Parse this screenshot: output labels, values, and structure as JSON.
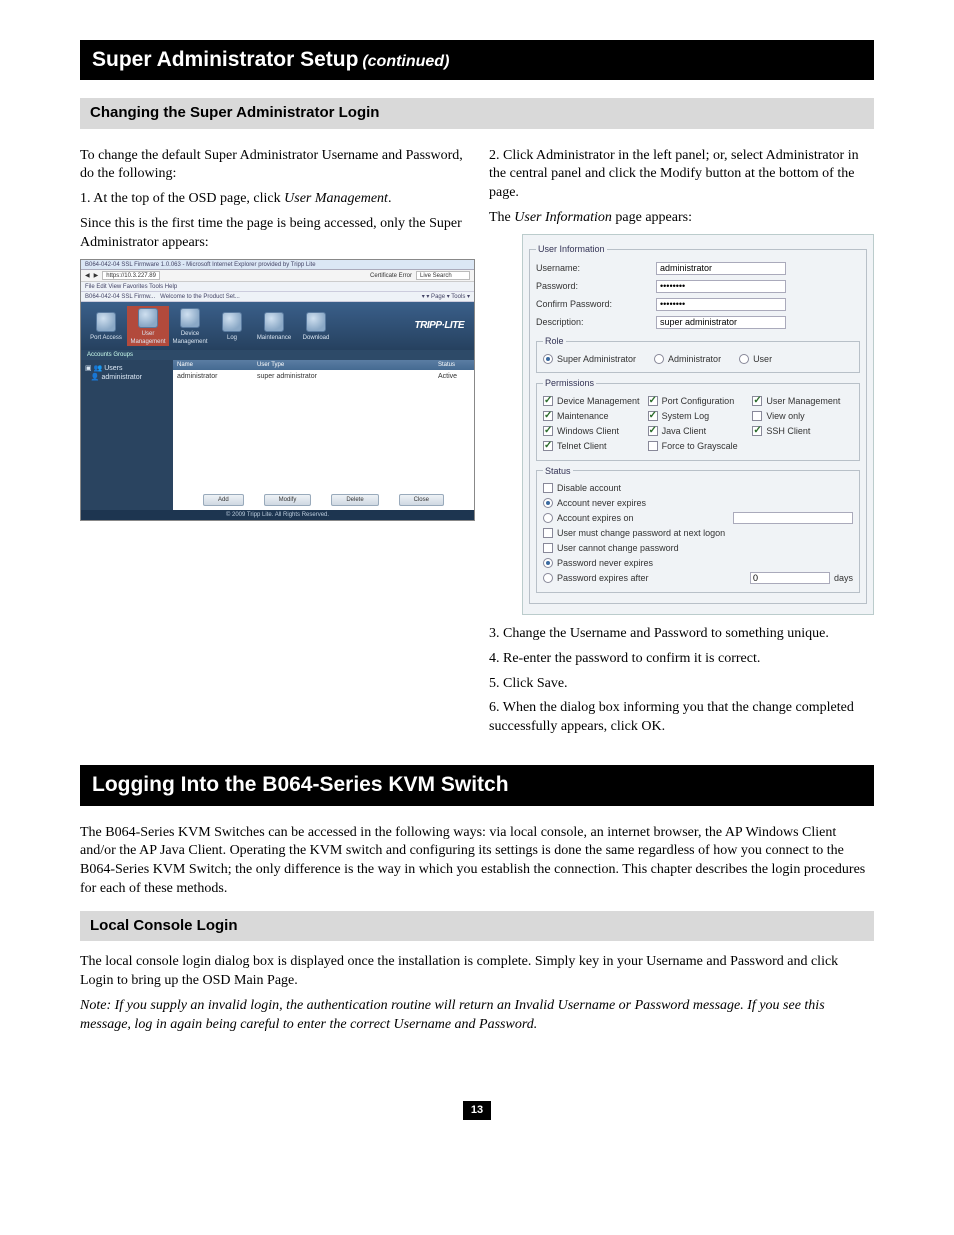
{
  "headers": {
    "h1_main": "Super Administrator Setup",
    "h1_sub": "(continued)",
    "h2_changing": "Changing the Super Administrator Login",
    "h3_logging": "Logging Into the B064-Series KVM Switch",
    "h4_local": "Local Console Login"
  },
  "left_col": {
    "p1": "To change the default Super Administrator Username and Password, do the following:",
    "p2_prefix": "1. At the top of the OSD page, click ",
    "p2_italic": "User Management",
    "p2_suffix": ".",
    "p3": "Since this is the first time the page is being accessed, only the Super Administrator appears:"
  },
  "screenshot1": {
    "titlebar": "B064-042-04 SSL Firmware 1.0.063 - Microsoft Internet Explorer provided by Tripp Lite",
    "url": "https://10.3.227.89",
    "menu": "File   Edit   View   Favorites   Tools   Help",
    "favtext": "B064-042-04 SSL Firmw...",
    "welcome": "Welcome to the Product Set...",
    "tools": [
      "Port Access",
      "User Management",
      "Device Management",
      "Log",
      "Maintenance",
      "Download"
    ],
    "logo": "TRIPP·LITE",
    "tabs": "Accounts   Groups",
    "tree": {
      "root": "Users",
      "item": "administrator"
    },
    "cols": [
      "Name",
      "",
      "User Type",
      "",
      "Status"
    ],
    "row": {
      "name": "administrator",
      "type": "super administrator",
      "status": "Active"
    },
    "buttons": [
      "Add",
      "Modify",
      "Delete",
      "Close"
    ],
    "footer": "© 2009 Tripp Lite. All Rights Reserved."
  },
  "right_col": {
    "p1": "2. Click Administrator in the left panel; or, select Administrator in the central panel and click the Modify button at the bottom of the page.",
    "p2_prefix": "The ",
    "p2_italic": "User Information",
    "p2_suffix": " page appears:",
    "p3": "3. Change the Username and Password to something unique.",
    "p4": "4. Re-enter the password to confirm it is correct.",
    "p5": "5. Click Save.",
    "p6": "6. When the dialog box informing you that the change completed successfully appears, click OK."
  },
  "screenshot2": {
    "group": "User Information",
    "fields": {
      "username_label": "Username:",
      "username_value": "administrator",
      "password_label": "Password:",
      "password_value": "••••••••",
      "confirm_label": "Confirm Password:",
      "confirm_value": "••••••••",
      "description_label": "Description:",
      "description_value": "super administrator"
    },
    "role": {
      "legend": "Role",
      "options": [
        "Super Administrator",
        "Administrator",
        "User"
      ],
      "selected": 0
    },
    "permissions": {
      "legend": "Permissions",
      "items": [
        {
          "label": "Device Management",
          "checked": true
        },
        {
          "label": "Port Configuration",
          "checked": true
        },
        {
          "label": "User Management",
          "checked": true
        },
        {
          "label": "Maintenance",
          "checked": true
        },
        {
          "label": "System Log",
          "checked": true
        },
        {
          "label": "View only",
          "checked": false
        },
        {
          "label": "Windows Client",
          "checked": true
        },
        {
          "label": "Java Client",
          "checked": true
        },
        {
          "label": "SSH Client",
          "checked": true
        },
        {
          "label": "Telnet Client",
          "checked": true
        },
        {
          "label": "Force to Grayscale",
          "checked": false
        }
      ]
    },
    "status": {
      "legend": "Status",
      "disable": {
        "label": "Disable account",
        "checked": false
      },
      "never": {
        "label": "Account never expires",
        "selected": true
      },
      "expires_on": {
        "label": "Account expires on",
        "selected": false,
        "value": ""
      },
      "must_change": {
        "label": "User must change password at next logon",
        "checked": false
      },
      "cannot_change": {
        "label": "User cannot change password",
        "checked": false
      },
      "pw_never": {
        "label": "Password never expires",
        "selected": true
      },
      "pw_after": {
        "label": "Password expires after",
        "selected": false,
        "value": "0",
        "unit": "days"
      }
    }
  },
  "section2": {
    "p1": "The B064-Series KVM Switches can be accessed in the following ways: via local console, an internet browser, the AP Windows Client and/or the AP Java Client. Operating the KVM switch and configuring its settings is done the same regardless of how you connect to the B064-Series KVM Switch; the only difference is the way in which you establish the connection. This chapter describes the login procedures for each of these methods."
  },
  "section3": {
    "p1": "The local console login dialog box is displayed once the installation is complete. Simply key in your Username and Password and click Login to bring up the OSD Main Page.",
    "p2": "Note: If you supply an invalid login, the authentication routine will return an Invalid Username or Password message. If you see this message, log in again being careful to enter the correct Username and Password."
  },
  "page_number": "13"
}
